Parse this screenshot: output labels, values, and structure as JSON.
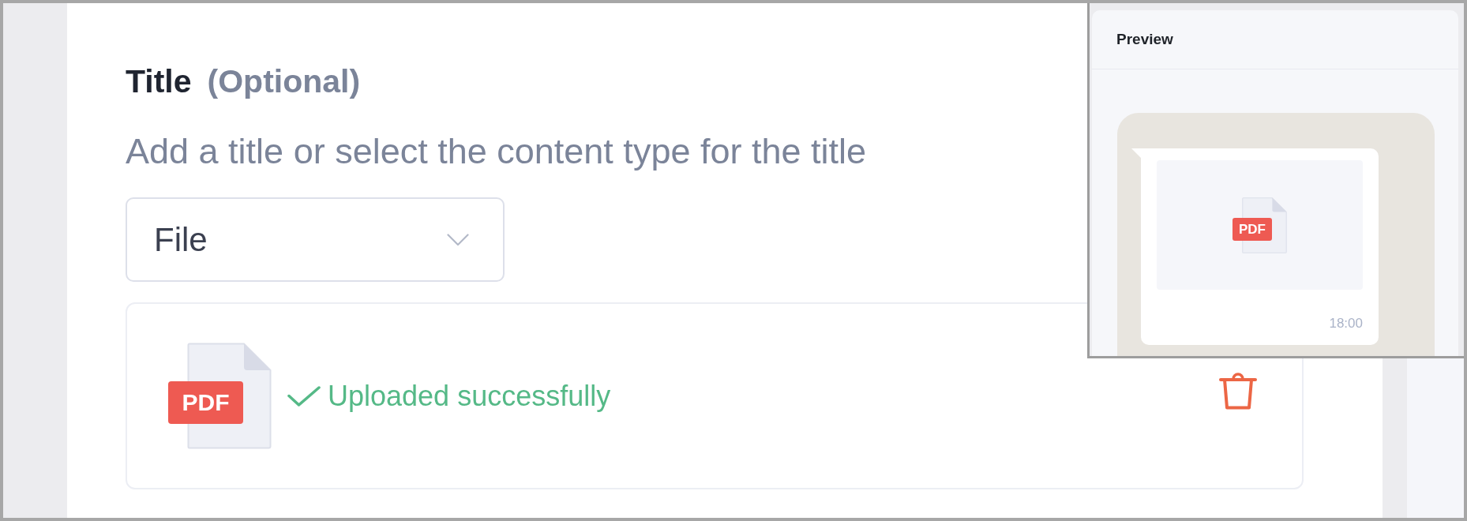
{
  "form": {
    "label": "Title",
    "hint": "(Optional)",
    "description": "Add a title or select the content type for the title",
    "content_type": {
      "value": "File"
    }
  },
  "upload": {
    "file_type": "PDF",
    "status": "Uploaded successfully"
  },
  "preview": {
    "title": "Preview",
    "message": {
      "file_type": "PDF",
      "time": "18:00"
    }
  }
}
